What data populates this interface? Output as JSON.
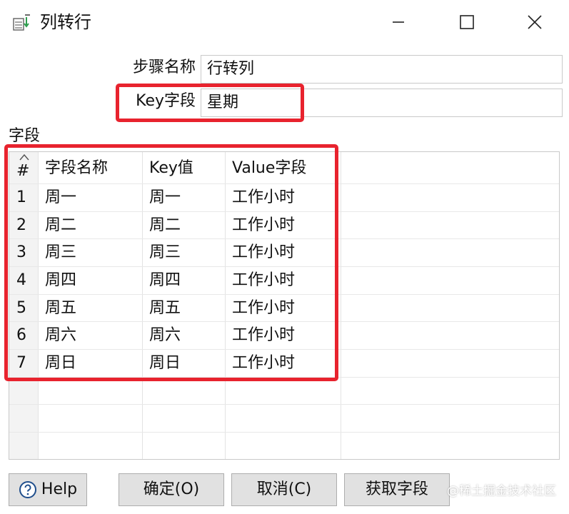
{
  "window": {
    "title": "列转行",
    "icon": "transform-step-icon"
  },
  "form": {
    "step_name_label": "步骤名称",
    "step_name_value": "行转列",
    "key_field_label": "Key字段",
    "key_field_value": "星期"
  },
  "fields_section": {
    "label": "字段",
    "columns": [
      "#",
      "字段名称",
      "Key值",
      "Value字段"
    ],
    "rows": [
      {
        "num": "1",
        "name": "周一",
        "key": "周一",
        "value": "工作小时"
      },
      {
        "num": "2",
        "name": "周二",
        "key": "周二",
        "value": "工作小时"
      },
      {
        "num": "3",
        "name": "周三",
        "key": "周三",
        "value": "工作小时"
      },
      {
        "num": "4",
        "name": "周四",
        "key": "周四",
        "value": "工作小时"
      },
      {
        "num": "5",
        "name": "周五",
        "key": "周五",
        "value": "工作小时"
      },
      {
        "num": "6",
        "name": "周六",
        "key": "周六",
        "value": "工作小时"
      },
      {
        "num": "7",
        "name": "周日",
        "key": "周日",
        "value": "工作小时"
      }
    ]
  },
  "buttons": {
    "help": "Help",
    "ok": "确定(O)",
    "cancel": "取消(C)",
    "get_fields": "获取字段"
  },
  "watermark": "@稀土掘金技术社区",
  "colors": {
    "highlight_border": "#e8232e",
    "button_bg": "#e1e1e1",
    "help_icon": "#1f4e8c"
  }
}
